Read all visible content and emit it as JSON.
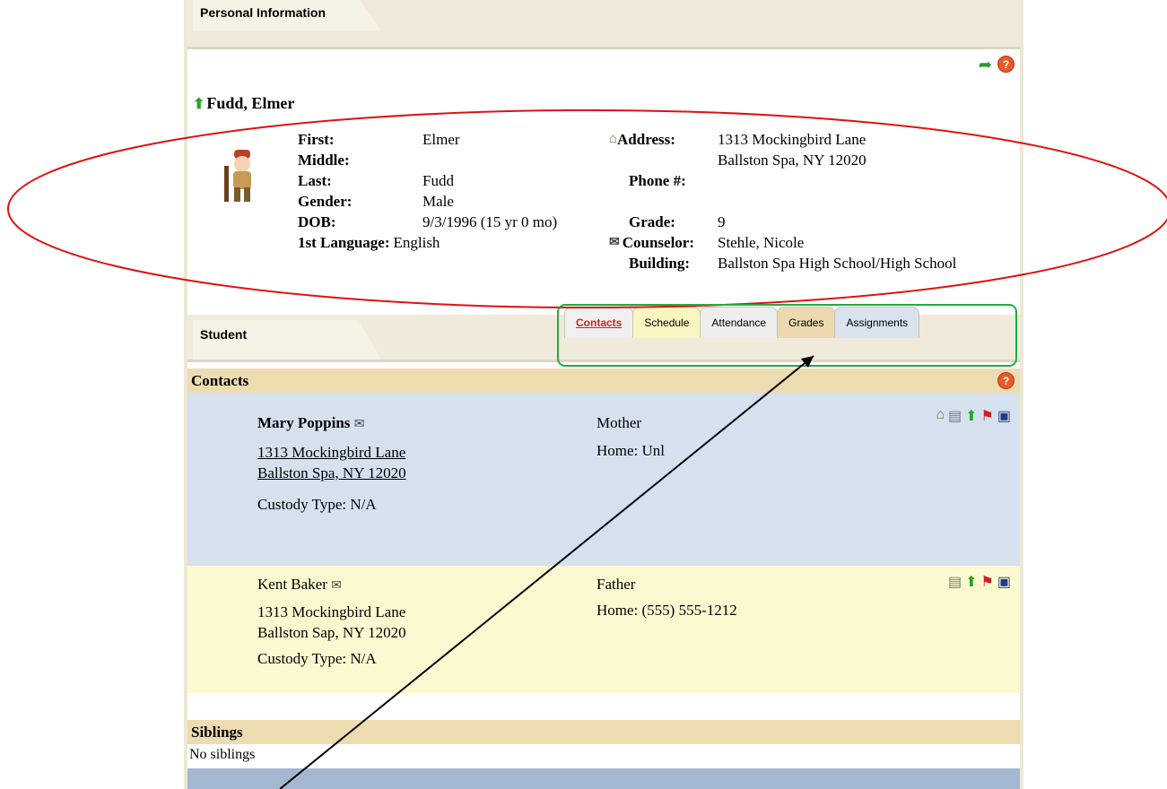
{
  "tabs": {
    "personal_info": "Personal Information",
    "student": "Student"
  },
  "student": {
    "full_name": "Fudd, Elmer",
    "fields_left": [
      {
        "label": "First:",
        "value": "Elmer"
      },
      {
        "label": "Middle:",
        "value": ""
      },
      {
        "label": "Last:",
        "value": "Fudd"
      },
      {
        "label": "Gender:",
        "value": "Male"
      },
      {
        "label": "DOB:",
        "value": "9/3/1996 (15 yr 0 mo)"
      },
      {
        "label": "1st Language:",
        "value": "English"
      }
    ],
    "address_label": "Address:",
    "address_line1": "1313 Mockingbird Lane",
    "address_line2": "Ballston Spa, NY 12020",
    "phone_label": "Phone #:",
    "phone_value": "",
    "grade_label": "Grade:",
    "grade_value": "9",
    "counselor_label": "Counselor:",
    "counselor_value": "Stehle, Nicole",
    "building_label": "Building:",
    "building_value": "Ballston Spa High School/High School"
  },
  "page_tabs": [
    "Contacts",
    "Schedule",
    "Attendance",
    "Grades",
    "Assignments"
  ],
  "contacts_header": "Contacts",
  "contacts": [
    {
      "name": "Mary  Poppins",
      "relation": "Mother",
      "address_line1": "1313 Mockingbird Lane",
      "address_line2": "Ballston Spa, NY 12020",
      "phone": "Home: Unl",
      "custody": "Custody Type: N/A"
    },
    {
      "name": "Kent  Baker",
      "relation": "Father",
      "address_line1": "1313 Mockingbird Lane",
      "address_line2": "Ballston Sap, NY 12020",
      "phone": "Home: (555) 555-1212",
      "custody": "Custody Type: N/A"
    }
  ],
  "siblings_header": "Siblings",
  "siblings_text": "No siblings",
  "colors": {
    "annotation_ellipse": "#e01010",
    "annotation_box": "#22aa44",
    "contact1_bg": "#d6e1ef",
    "contact2_bg": "#fcf9d0",
    "section_header_bg": "#eedcb1"
  }
}
